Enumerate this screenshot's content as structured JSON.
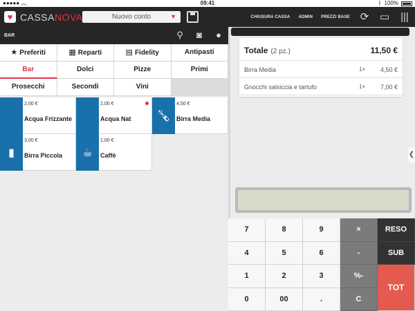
{
  "status": {
    "time": "09:41",
    "battery": "100%"
  },
  "topbar": {
    "brand_part1": "CASSA",
    "brand_part2": "NOVA",
    "conto_select": "Nuovo conto",
    "links": [
      "CHIUSURA CASSA",
      "ADMIN",
      "PREZZI BASE"
    ]
  },
  "category": {
    "title": "BAR"
  },
  "tabs": [
    [
      {
        "label": "Preferiti",
        "icon": "★"
      },
      {
        "label": "Reparti",
        "icon": "▦"
      },
      {
        "label": "Fidelity",
        "icon": "▤"
      },
      {
        "label": "Antipasti"
      }
    ],
    [
      {
        "label": "Bar",
        "active": true
      },
      {
        "label": "Dolci"
      },
      {
        "label": "Pizze"
      },
      {
        "label": "Primi"
      }
    ],
    [
      {
        "label": "Prosecchi"
      },
      {
        "label": "Secondi"
      },
      {
        "label": "Vini"
      }
    ]
  ],
  "products": [
    {
      "price": "2,00 €",
      "name": "Acqua Frizzante",
      "icon": ""
    },
    {
      "price": "2,00 €",
      "name": "Acqua Nat",
      "icon": "",
      "flag": true
    },
    {
      "price": "4,50 €",
      "name": "Birra Media",
      "icon": "bottle-icon"
    },
    {
      "price": "3,00 €",
      "name": "Birra Piccola",
      "icon": "bottle-icon"
    },
    {
      "price": "1,00 €",
      "name": "Caffè",
      "icon": "cup-icon"
    }
  ],
  "receipt": {
    "total_label": "Totale",
    "total_count": "(2 pz.)",
    "total_value": "11,50 €",
    "lines": [
      {
        "name": "Birra Media",
        "qty": "1×",
        "price": "4,50 €"
      },
      {
        "name": "Gnocchi salsiccia e tartufo",
        "qty": "1×",
        "price": "7,00 €"
      }
    ]
  },
  "display": {
    "value": ""
  },
  "keypad": {
    "rows": [
      [
        "7",
        "8",
        "9",
        "×",
        "RESO"
      ],
      [
        "4",
        "5",
        "6",
        "-",
        "SUB"
      ],
      [
        "1",
        "2",
        "3",
        "%-",
        "TOT"
      ],
      [
        "0",
        "00",
        ".",
        "C"
      ]
    ]
  }
}
